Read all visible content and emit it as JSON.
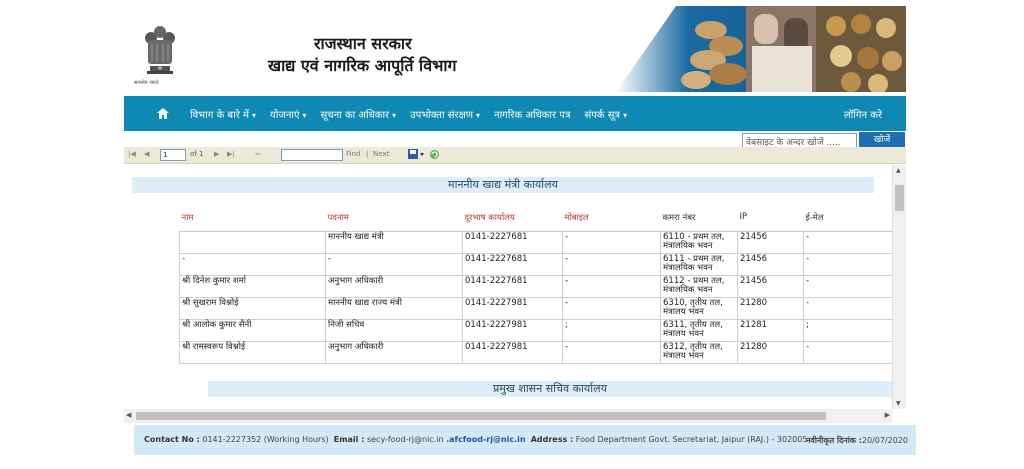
{
  "header": {
    "title_line1": "राजस्थान सरकार",
    "title_line2": "खाद्य एवं नागरिक आपूर्ति विभाग",
    "emblem_caption": "सत्यमेव जयते",
    "brand_color": "#0d89b3"
  },
  "nav": {
    "items": [
      {
        "label": "विभाग के बारे में",
        "has_dropdown": true
      },
      {
        "label": "योजनाएं",
        "has_dropdown": true
      },
      {
        "label": "सूचना का अधिकार",
        "has_dropdown": true
      },
      {
        "label": "उपभोक्ता संरक्षण",
        "has_dropdown": true
      },
      {
        "label": "नागरिक अधिकार पत्र",
        "has_dropdown": false
      },
      {
        "label": "संपर्क सूत्र",
        "has_dropdown": true
      }
    ],
    "login_label": "लॉगिन करे",
    "home_icon": "home-icon"
  },
  "search": {
    "placeholder": "वेबसाइट के अन्दर खोजें .....",
    "button_label": "खोजें"
  },
  "toolbar": {
    "page_value": "1",
    "of_label": "of 1",
    "find_label": "Find",
    "separator": "|",
    "next_label": "Next"
  },
  "report": {
    "section1_title": "माननीय खाद्य मंत्री कार्यालय",
    "section2_title": "प्रमुख शासन सचिव कार्यालय",
    "columns": [
      "नाम",
      "पदनाम",
      "दूरभाष कार्यालय",
      "मोबाइल",
      "कमरा नंबर",
      "IP",
      "ई-मेल"
    ],
    "rows": [
      [
        "",
        "माननीय खाद्य मंत्री",
        "0141-2227681",
        "-",
        "6110 - प्रथम तल, मंत्रालयिक भवन",
        "21456",
        "-"
      ],
      [
        "-",
        "-",
        "0141-2227681",
        "-",
        "6111 - प्रथम तल, मंत्रालयिक भवन",
        "21456",
        "-"
      ],
      [
        "श्री दिनेश कुमार शर्मा",
        "अनुभाग अधिकारी",
        "0141-2227681",
        "-",
        "6112 - प्रथम तल, मंत्रालयिक भवन",
        "21456",
        "-"
      ],
      [
        "श्री सुखराम विश्नोई",
        "माननीय खाद्य राज्य मंत्री",
        "0141-2227981",
        "-",
        "6310, तृतीय तल, मंत्रालय भवन",
        "21280",
        "-"
      ],
      [
        "श्री आलोक कुमार सैनी",
        "निजी सचिव",
        "0141-2227981",
        ";",
        "6311, तृतीय तल, मंत्रालय भवन",
        "21281",
        ";"
      ],
      [
        "श्री रामस्वरूप विश्नोई",
        "अनुभाग अधिकारी",
        "0141-2227981",
        "-",
        "6312, तृतीय तल, मंत्रालय भवन",
        "21280",
        "-"
      ]
    ]
  },
  "footer": {
    "contact_label": "Contact No :",
    "contact_value": "0141-2227352 (Working Hours)",
    "email_label": "Email :",
    "email_value1": "secy-food-rj@nic.in",
    "email_value2": ".afcfood-rj@nic.in",
    "address_label": "Address :",
    "address_value": "Food Department Govt. Secretariat, Jaipur (RAJ.) - 302005",
    "updated_label": "नवीनीकृत दिनांक :",
    "updated_value": "20/07/2020"
  }
}
